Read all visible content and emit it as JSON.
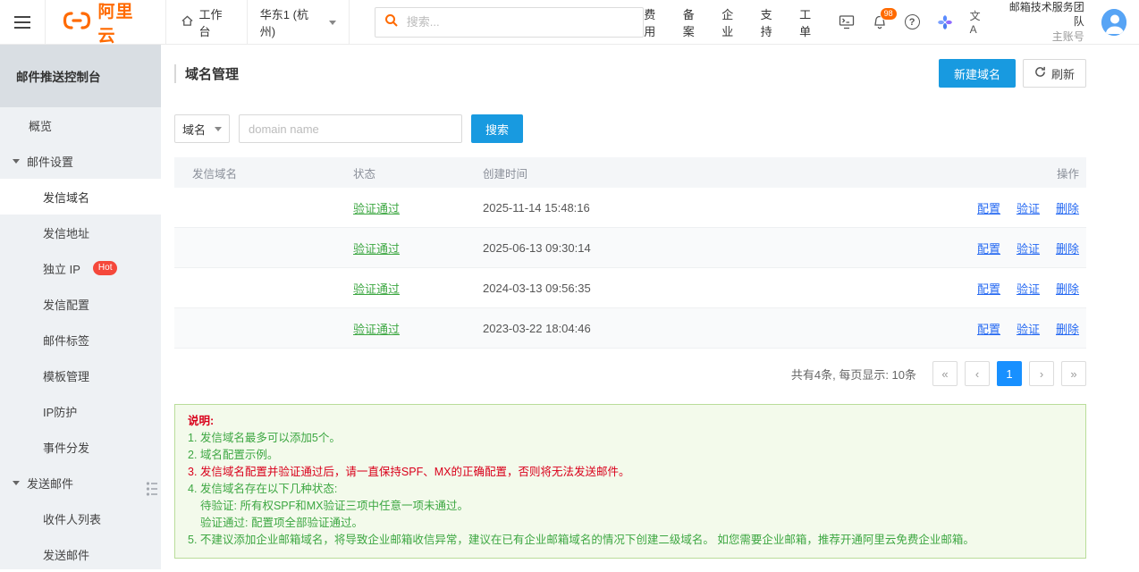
{
  "colors": {
    "brand_orange": "#FF6A00",
    "primary_blue": "#189AE0",
    "link_blue": "#2468F2",
    "success_green": "#3DA742",
    "alert_red": "#D9001B"
  },
  "topbar": {
    "logo": "阿里云",
    "workbench": "工作台",
    "region": "华东1 (杭州)",
    "search_placeholder": "搜索...",
    "links": [
      "费用",
      "备案",
      "企业",
      "支持",
      "工单"
    ],
    "notification_count": "98",
    "help_glyph": "?",
    "lang_glyph": "文A",
    "team_name": "邮箱技术服务团队",
    "account_type": "主账号"
  },
  "sidebar": {
    "title": "邮件推送控制台",
    "items": [
      {
        "label": "概览"
      },
      {
        "label": "邮件设置"
      },
      {
        "label": "发信域名"
      },
      {
        "label": "发信地址"
      },
      {
        "label": "独立 IP",
        "badge": "Hot"
      },
      {
        "label": "发信配置"
      },
      {
        "label": "邮件标签"
      },
      {
        "label": "模板管理"
      },
      {
        "label": "IP防护"
      },
      {
        "label": "事件分发"
      },
      {
        "label": "发送邮件"
      },
      {
        "label": "收件人列表"
      },
      {
        "label": "发送邮件"
      }
    ]
  },
  "page": {
    "title": "域名管理",
    "create_button": "新建域名",
    "refresh_button": "刷新"
  },
  "filter": {
    "field": "域名",
    "placeholder": "domain name",
    "search_button": "搜索"
  },
  "table": {
    "columns": {
      "domain": "发信域名",
      "status": "状态",
      "created": "创建时间",
      "actions": "操作"
    },
    "actions": {
      "configure": "配置",
      "verify": "验证",
      "remove": "删除"
    },
    "rows": [
      {
        "status": "验证通过",
        "created": "2025-11-14 15:48:16"
      },
      {
        "status": "验证通过",
        "created": "2025-06-13 09:30:14"
      },
      {
        "status": "验证通过",
        "created": "2024-03-13 09:56:35"
      },
      {
        "status": "验证通过",
        "created": "2023-03-22 18:04:46"
      }
    ]
  },
  "pagination": {
    "summary": "共有4条, 每页显示: 10条",
    "first": "«",
    "prev": "‹",
    "page": "1",
    "next": "›",
    "last": "»"
  },
  "notice": {
    "title": "说明:",
    "lines": [
      "1. 发信域名最多可以添加5个。",
      "2. 域名配置示例。",
      "3. 发信域名配置并验证通过后，请一直保持SPF、MX的正确配置，否则将无法发送邮件。",
      "4. 发信域名存在以下几种状态:",
      "待验证: 所有权SPF和MX验证三项中任意一项未通过。",
      "验证通过: 配置项全部验证通过。",
      "5. 不建议添加企业邮箱域名，将导致企业邮箱收信异常，建议在已有企业邮箱域名的情况下创建二级域名。 如您需要企业邮箱，推荐开通阿里云免费企业邮箱。"
    ]
  }
}
